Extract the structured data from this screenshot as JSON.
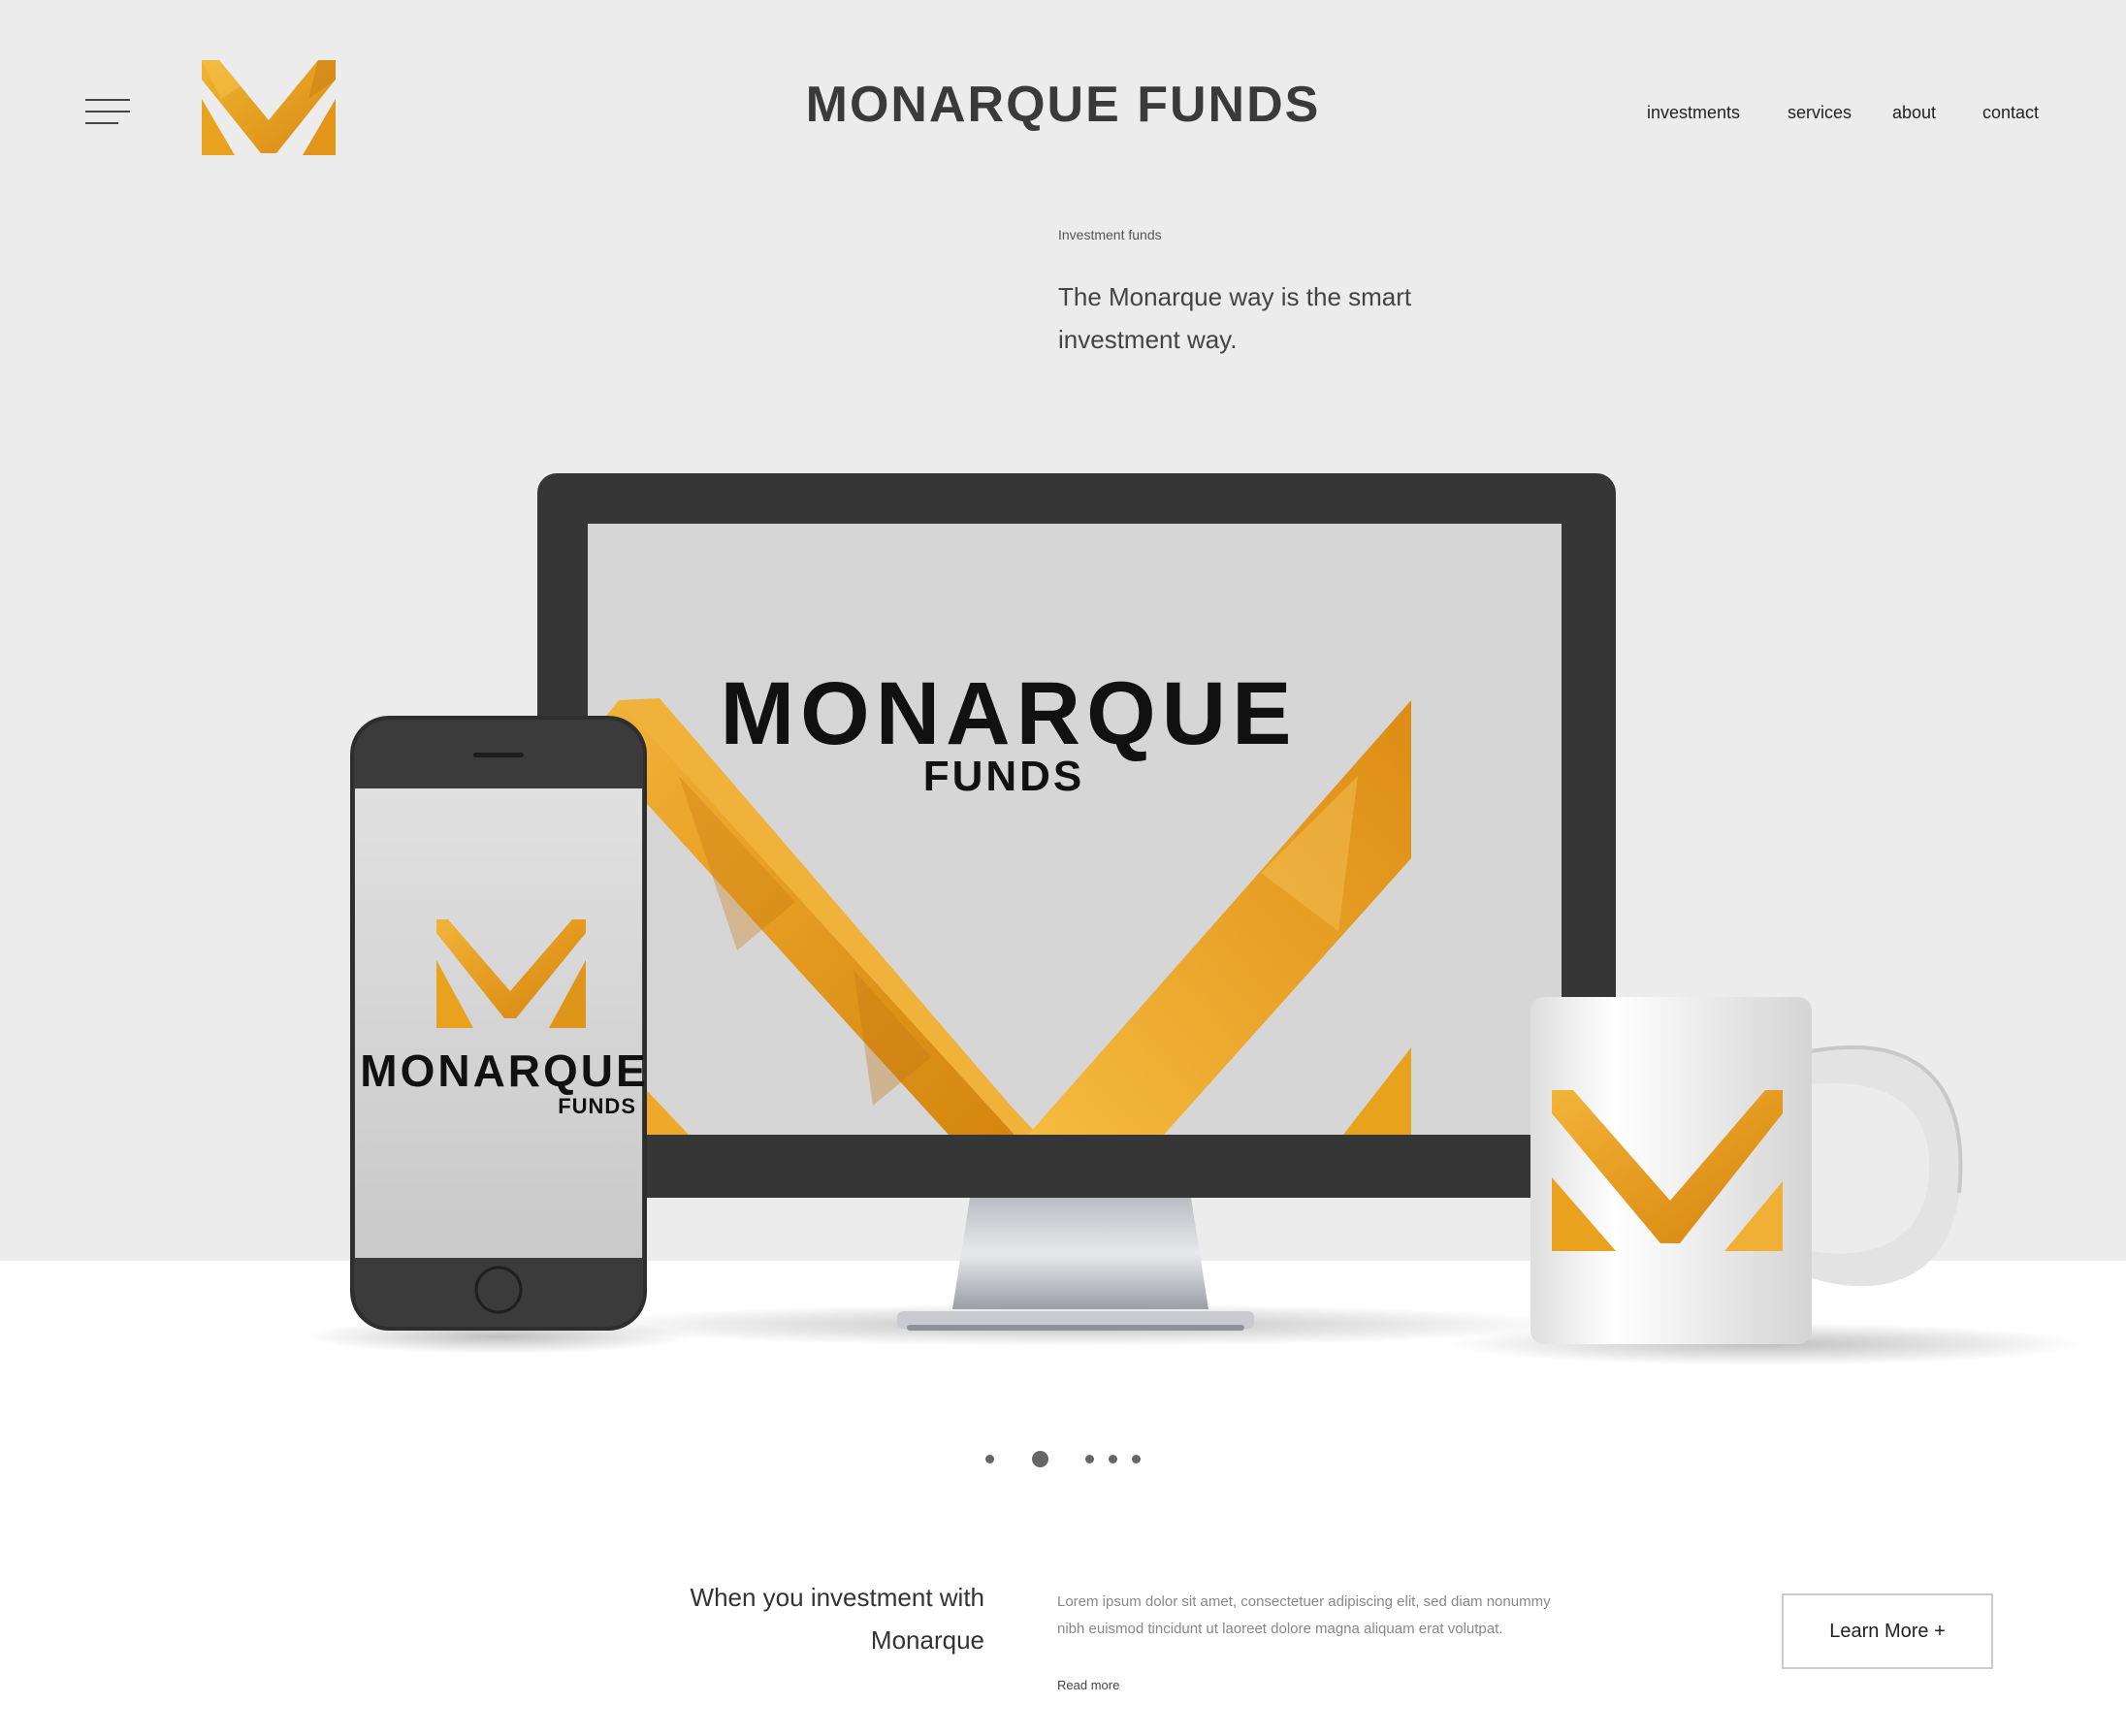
{
  "brand": {
    "title": "MONARQUE FUNDS",
    "accent": "#e8a21e",
    "dark": "#363636"
  },
  "nav": {
    "items": [
      "investments",
      "services",
      "about",
      "contact"
    ]
  },
  "hero": {
    "eyebrow": "Investment funds",
    "tagline": "The Monarque way is the smart investment way."
  },
  "devices": {
    "monitor_wordmark": "MONARQUE",
    "monitor_sub": "FUNDS",
    "phone_wordmark": "MONARQUE",
    "phone_sub": "FUNDS"
  },
  "carousel": {
    "count": 5,
    "active_index": 1
  },
  "footer_section": {
    "heading": "When you investment with Monarque",
    "body": "Lorem ipsum dolor sit amet, consectetuer adipiscing elit, sed diam nonummy nibh euismod tincidunt ut laoreet dolore magna aliquam erat volutpat.",
    "read_more": "Read more",
    "cta": "Learn More +"
  },
  "icons": [
    "menu-icon",
    "logo-m-icon",
    "phone-home-button-icon"
  ]
}
